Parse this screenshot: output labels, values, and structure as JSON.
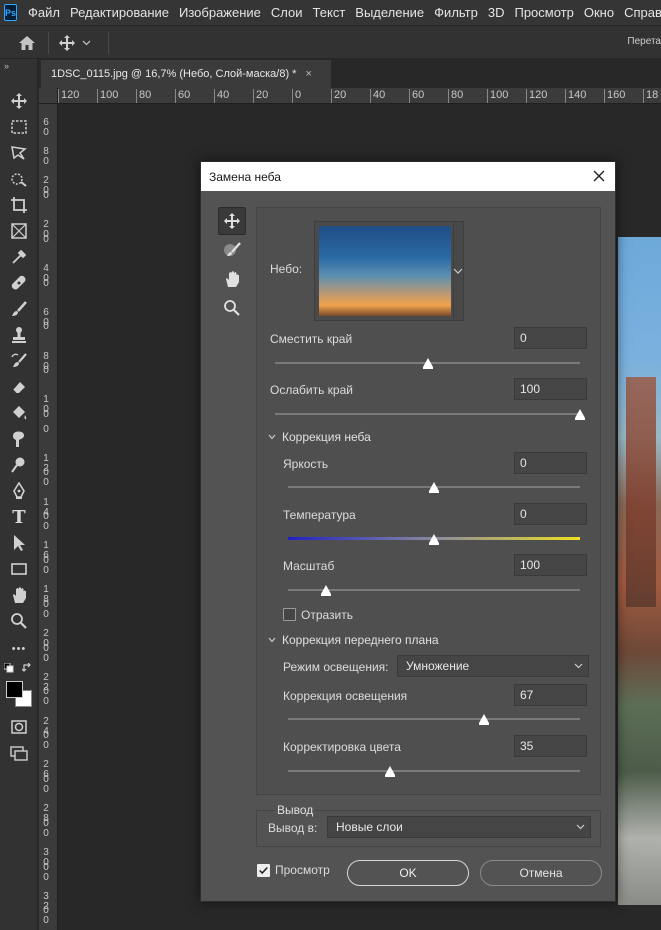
{
  "app": {
    "logo_text": "Ps"
  },
  "menu": [
    "Файл",
    "Редактирование",
    "Изображение",
    "Слои",
    "Текст",
    "Выделение",
    "Фильтр",
    "3D",
    "Просмотр",
    "Окно",
    "Справка"
  ],
  "options_bar": {
    "right_label": "Перета"
  },
  "document": {
    "tab_title": "1DSC_0115.jpg @ 16,7% (Небо, Слой-маска/8) *",
    "close_glyph": "×"
  },
  "ruler_h": [
    "120",
    "100",
    "80",
    "60",
    "40",
    "20",
    "0",
    "20",
    "40",
    "60",
    "80",
    "100",
    "120",
    "140",
    "160",
    "18"
  ],
  "ruler_v": [
    "60",
    "",
    "80",
    "",
    "20",
    "0",
    "",
    "20",
    "0",
    "",
    "40",
    "0",
    "",
    "60",
    "0",
    "",
    "80",
    "0",
    "",
    "10",
    "0",
    "0",
    "",
    "12",
    "00",
    "",
    "14",
    "00",
    "",
    "16",
    "00",
    "",
    "18",
    "00",
    "",
    "20",
    "00",
    "",
    "22",
    "00",
    "",
    "24",
    "00",
    "",
    "26",
    "00",
    "",
    "28",
    "00",
    "",
    "30",
    "00",
    "",
    "32",
    "00",
    "",
    "34"
  ],
  "toolbar": {
    "grip": "»",
    "tools": [
      "move",
      "marquee",
      "lasso",
      "quick-select",
      "crop",
      "frame",
      "eyedropper",
      "healing",
      "brush",
      "stamp",
      "history-brush",
      "eraser",
      "paint-bucket",
      "smudge",
      "dodge",
      "pen",
      "type",
      "path-select",
      "rectangle",
      "hand",
      "zoom",
      "more"
    ],
    "type_glyph": "T",
    "more_glyph": "•••"
  },
  "dialog": {
    "title": "Замена неба",
    "tools": [
      "move",
      "sky-brush",
      "hand",
      "zoom"
    ],
    "sky": {
      "label": "Небо:"
    },
    "shift_edge": {
      "label": "Сместить край",
      "value": "0",
      "slider": 0.5
    },
    "fade_edge": {
      "label": "Ослабить край",
      "value": "100",
      "slider": 1.0
    },
    "sky_adjust": {
      "title": "Коррекция неба",
      "brightness": {
        "label": "Яркость",
        "value": "0",
        "slider": 0.5
      },
      "temperature": {
        "label": "Температура",
        "value": "0",
        "slider": 0.5
      },
      "scale": {
        "label": "Масштаб",
        "value": "100",
        "slider": 0.13
      },
      "flip": {
        "label": "Отразить",
        "checked": false
      }
    },
    "foreground": {
      "title": "Коррекция переднего плана",
      "lighting_mode": {
        "label": "Режим освещения:",
        "value": "Умножение"
      },
      "lighting_adjust": {
        "label": "Коррекция освещения",
        "value": "67",
        "slider": 0.67
      },
      "color_adjust": {
        "label": "Корректировка цвета",
        "value": "35",
        "slider": 0.35
      }
    },
    "output": {
      "title": "Вывод",
      "label": "Вывод в:",
      "value": "Новые слои"
    },
    "preview": {
      "label": "Просмотр",
      "checked": true
    },
    "ok_label": "OK",
    "cancel_label": "Отмена"
  },
  "colors": {
    "accent": "#31a8ff",
    "temp_cold": "#2020c8",
    "temp_warm": "#f0e020",
    "foreground": "#000000",
    "background": "#ffffff"
  }
}
